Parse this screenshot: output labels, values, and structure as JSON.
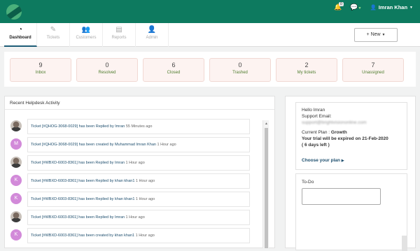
{
  "header": {
    "notifications_count": "0",
    "user_name": "Imran Khan"
  },
  "nav": {
    "tabs": [
      {
        "label": "Dashboard",
        "icon": "dashboard-icon"
      },
      {
        "label": "Tickets",
        "icon": "ticket-icon"
      },
      {
        "label": "Customers",
        "icon": "users-icon"
      },
      {
        "label": "Reports",
        "icon": "chart-icon"
      },
      {
        "label": "Admin",
        "icon": "user-icon"
      }
    ],
    "new_button": "New"
  },
  "stats": [
    {
      "value": "9",
      "label": "Inbox"
    },
    {
      "value": "0",
      "label": "Resolved"
    },
    {
      "value": "6",
      "label": "Closed"
    },
    {
      "value": "0",
      "label": "Trashed"
    },
    {
      "value": "2",
      "label": "My tickets"
    },
    {
      "value": "7",
      "label": "Unassigned"
    }
  ],
  "activity": {
    "title": "Recent Helpdesk Activity",
    "items": [
      {
        "avatar": "photo",
        "letter": "",
        "text": "Ticket [#QHOG-3068-0029] has been Replied by Imran",
        "ago": "55 Minutes ago"
      },
      {
        "avatar": "letter",
        "letter": "M",
        "text": "Ticket [#QHOG-3068-0029] has been created by Muhammad Imran Khan",
        "ago": "1 Hour ago"
      },
      {
        "avatar": "photo",
        "letter": "",
        "text": "Ticket [#WBXD-6003-8361] has been Replied by Imran",
        "ago": "1 Hour ago"
      },
      {
        "avatar": "letter",
        "letter": "K",
        "text": "Ticket [#WBXD-6003-8361] has been Replied by khan khan1",
        "ago": "1 Hour ago"
      },
      {
        "avatar": "letter",
        "letter": "K",
        "text": "Ticket [#WBXD-6003-8361] has been Replied by khan khan1",
        "ago": "1 Hour ago"
      },
      {
        "avatar": "photo",
        "letter": "",
        "text": "Ticket [#WBXD-6003-8361] has been Replied by Imran",
        "ago": "1 Hour ago"
      },
      {
        "avatar": "letter",
        "letter": "K",
        "text": "Ticket [#WBXD-6003-8361] has been created by khan khan1",
        "ago": "1 Hour ago"
      }
    ]
  },
  "plan": {
    "greeting": "Hello Imran",
    "support_label": "Support Email:",
    "support_email": "support@brightvisiononline.com",
    "current_plan_label": "Current Plan :",
    "current_plan": "Growth",
    "expiry": "Your trial will be expired on 21-Feb-2020",
    "days_left": "( 6 days left )",
    "choose_label": "Choose your plan"
  },
  "todo": {
    "title": "To-Do"
  },
  "colors": {
    "header_bg": "#0d7a5f",
    "stat_bg": "#fdf3f1",
    "stat_label": "#4e7d2e",
    "link": "#1f4f6e"
  }
}
